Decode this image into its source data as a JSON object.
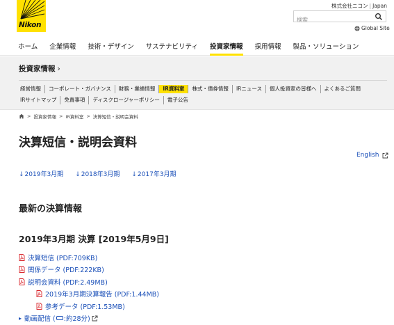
{
  "header": {
    "logo_text": "Nikon",
    "company_name": "株式会社ニコン",
    "country": "Japan",
    "search_placeholder": "検索",
    "global_site": "Global Site"
  },
  "main_nav": [
    {
      "label": "ホーム"
    },
    {
      "label": "企業情報"
    },
    {
      "label": "技術・デザイン"
    },
    {
      "label": "サステナビリティ"
    },
    {
      "label": "投資家情報"
    },
    {
      "label": "採用情報"
    },
    {
      "label": "製品・ソリューション"
    }
  ],
  "section": {
    "title": "投資家情報",
    "chevron": "›"
  },
  "subnav_row1": [
    {
      "label": "経営情報"
    },
    {
      "label": "コーポレート・ガバナンス"
    },
    {
      "label": "財務・業績情報"
    },
    {
      "label": "IR資料室"
    },
    {
      "label": "株式・債券情報"
    },
    {
      "label": "IRニュース"
    },
    {
      "label": "個人投資家の皆様へ"
    },
    {
      "label": "よくあるご質問"
    }
  ],
  "subnav_row2": [
    {
      "label": "IRサイトマップ"
    },
    {
      "label": "免責事項"
    },
    {
      "label": "ディスクロージャーポリシー"
    },
    {
      "label": "電子公告"
    }
  ],
  "breadcrumb": [
    {
      "label": "投資家情報"
    },
    {
      "label": "IR資料室"
    },
    {
      "label": "決算短信・説明会資料"
    }
  ],
  "breadcrumb_sep": ">",
  "page_title": "決算短信・説明会資料",
  "english_link": "English",
  "year_links": [
    {
      "label": "2019年3月期"
    },
    {
      "label": "2018年3月期"
    },
    {
      "label": "2017年3月期"
    }
  ],
  "section_heading": "最新の決算情報",
  "subsection_heading": "2019年3月期 決算 [2019年5月9日]",
  "documents": [
    {
      "label": "決算短信 (PDF:709KB)"
    },
    {
      "label": "関係データ (PDF:222KB)"
    },
    {
      "label": "説明会資料 (PDF:2.49MB)"
    },
    {
      "label": "2019年3月期決算報告 (PDF:1.44MB)"
    },
    {
      "label": "参考データ (PDF:1.53MB)"
    }
  ],
  "video": {
    "prefix": "動画配信 (",
    "suffix": ":約28分)"
  },
  "colors": {
    "brand_yellow": "#ffe100",
    "link_blue": "#1a4fb8",
    "pdf_red": "#d9262c"
  }
}
